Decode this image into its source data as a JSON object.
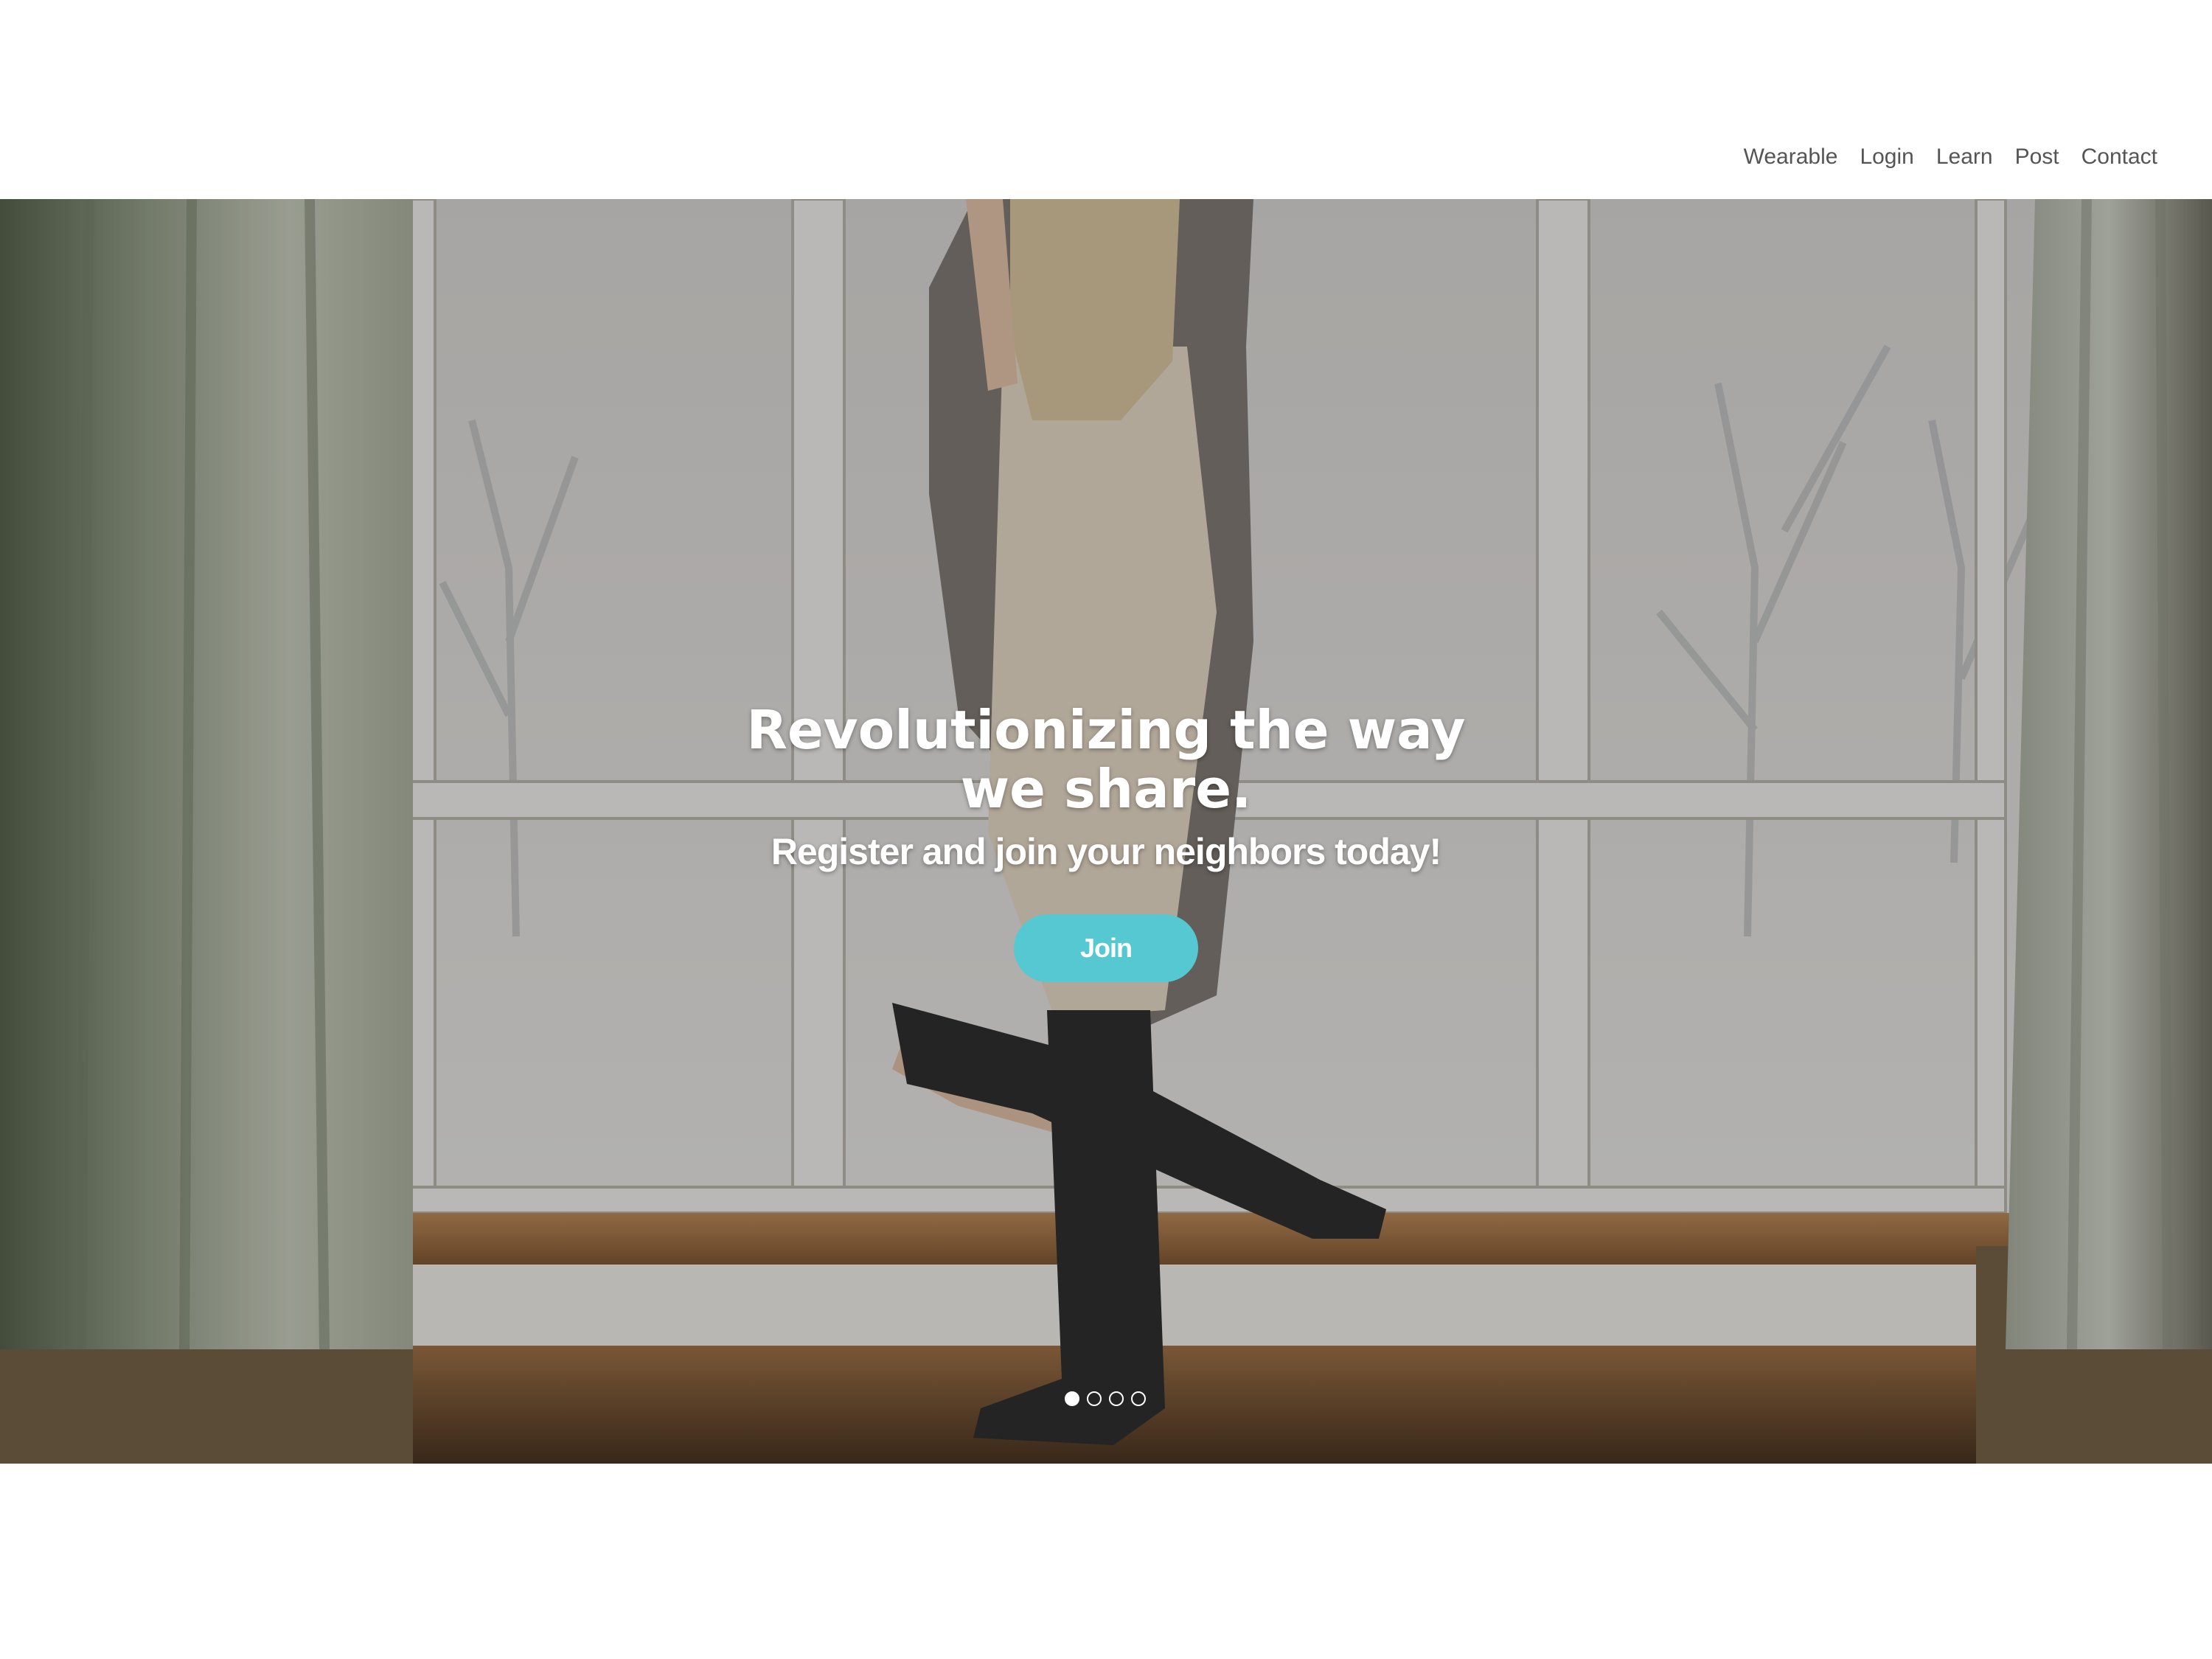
{
  "nav": {
    "items": [
      {
        "label": "Wearable"
      },
      {
        "label": "Login"
      },
      {
        "label": "Learn"
      },
      {
        "label": "Post"
      },
      {
        "label": "Contact"
      }
    ]
  },
  "hero": {
    "title_line1": "Revolutionizing the way",
    "title_line2": "we share.",
    "subtitle": "Register and join your neighbors today!",
    "button_label": "Join",
    "button_color": "#56c8d2",
    "slides": {
      "count": 4,
      "active_index": 0
    }
  }
}
